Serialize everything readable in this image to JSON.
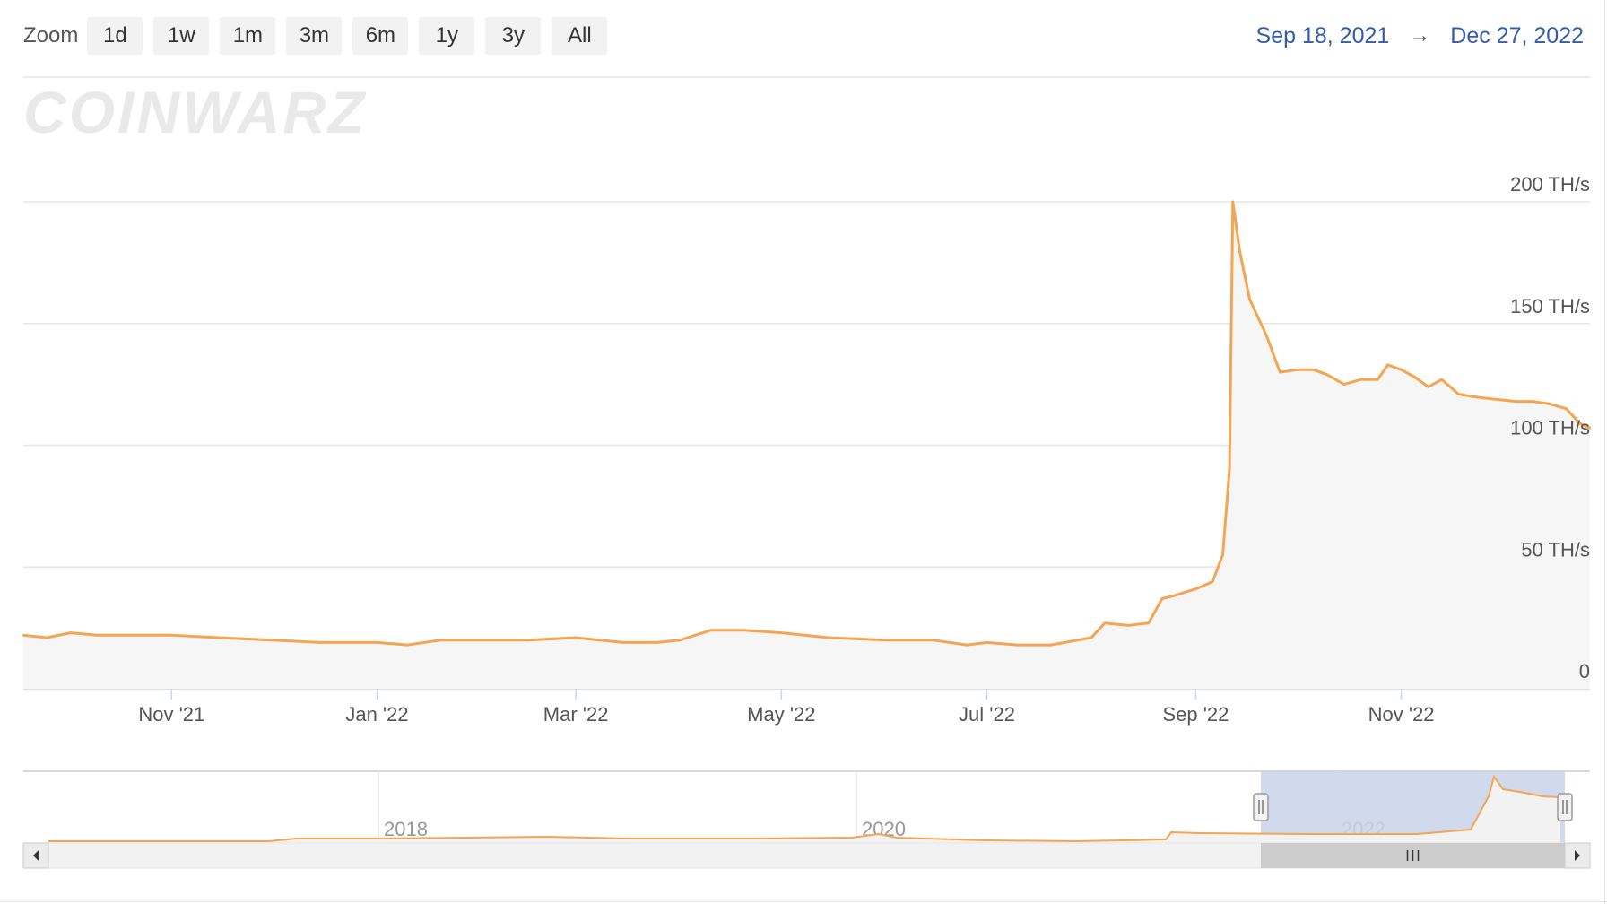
{
  "zoom": {
    "label": "Zoom",
    "buttons": [
      "1d",
      "1w",
      "1m",
      "3m",
      "6m",
      "1y",
      "3y",
      "All"
    ]
  },
  "range": {
    "from": "Sep 18, 2021",
    "arrow": "→",
    "to": "Dec 27, 2022"
  },
  "watermark": "COINWARZ",
  "colors": {
    "series": "#f5a551",
    "area_fill": "#f6f6f6",
    "navigator_mask": "#c9d4ea",
    "gridline": "#e6e6e6",
    "range_text": "#335cad"
  },
  "chart_data": {
    "type": "area",
    "ylim": [
      0,
      200
    ],
    "y_ticks": [
      "0",
      "50 TH/s",
      "100 TH/s",
      "150 TH/s",
      "200 TH/s"
    ],
    "y_tick_values": [
      0,
      50,
      100,
      150,
      200
    ],
    "x_ticks": [
      "Nov '21",
      "Jan '22",
      "Mar '22",
      "May '22",
      "Jul '22",
      "Sep '22",
      "Nov '22"
    ],
    "x_tick_dates": [
      "2021-11-01",
      "2022-01-01",
      "2022-03-01",
      "2022-05-01",
      "2022-07-01",
      "2022-09-01",
      "2022-11-01"
    ],
    "xlim": [
      "2021-09-18",
      "2022-12-27"
    ],
    "grid": true,
    "series": [
      {
        "x": [
          "2021-09-18",
          "2021-09-25",
          "2021-10-02",
          "2021-10-10",
          "2021-10-20",
          "2021-11-01",
          "2021-11-15",
          "2021-12-01",
          "2021-12-15",
          "2022-01-01",
          "2022-01-10",
          "2022-01-20",
          "2022-02-01",
          "2022-02-15",
          "2022-03-01",
          "2022-03-15",
          "2022-03-25",
          "2022-04-01",
          "2022-04-10",
          "2022-04-20",
          "2022-05-01",
          "2022-05-15",
          "2022-06-01",
          "2022-06-15",
          "2022-06-25",
          "2022-07-01",
          "2022-07-10",
          "2022-07-20",
          "2022-08-01",
          "2022-08-05",
          "2022-08-12",
          "2022-08-18",
          "2022-08-22",
          "2022-08-25",
          "2022-09-01",
          "2022-09-06",
          "2022-09-09",
          "2022-09-11",
          "2022-09-12",
          "2022-09-14",
          "2022-09-17",
          "2022-09-22",
          "2022-09-26",
          "2022-10-01",
          "2022-10-06",
          "2022-10-10",
          "2022-10-15",
          "2022-10-20",
          "2022-10-25",
          "2022-10-28",
          "2022-11-01",
          "2022-11-05",
          "2022-11-09",
          "2022-11-13",
          "2022-11-18",
          "2022-11-22",
          "2022-11-28",
          "2022-12-05",
          "2022-12-10",
          "2022-12-15",
          "2022-12-20",
          "2022-12-24",
          "2022-12-27"
        ],
        "y": [
          22,
          21,
          23,
          22,
          22,
          22,
          21,
          20,
          19,
          19,
          18,
          20,
          20,
          20,
          21,
          19,
          19,
          20,
          24,
          24,
          23,
          21,
          20,
          20,
          18,
          19,
          18,
          18,
          21,
          27,
          26,
          27,
          37,
          38,
          41,
          44,
          55,
          90,
          200,
          180,
          160,
          145,
          130,
          131,
          131,
          129,
          125,
          127,
          127,
          133,
          131,
          128,
          124,
          127,
          121,
          120,
          119,
          118,
          118,
          117,
          115,
          109,
          107
        ]
      }
    ],
    "navigator": {
      "x_labels": [
        "2018",
        "2020",
        "2022"
      ],
      "selected": [
        "2021-09-18",
        "2022-12-27"
      ]
    }
  }
}
